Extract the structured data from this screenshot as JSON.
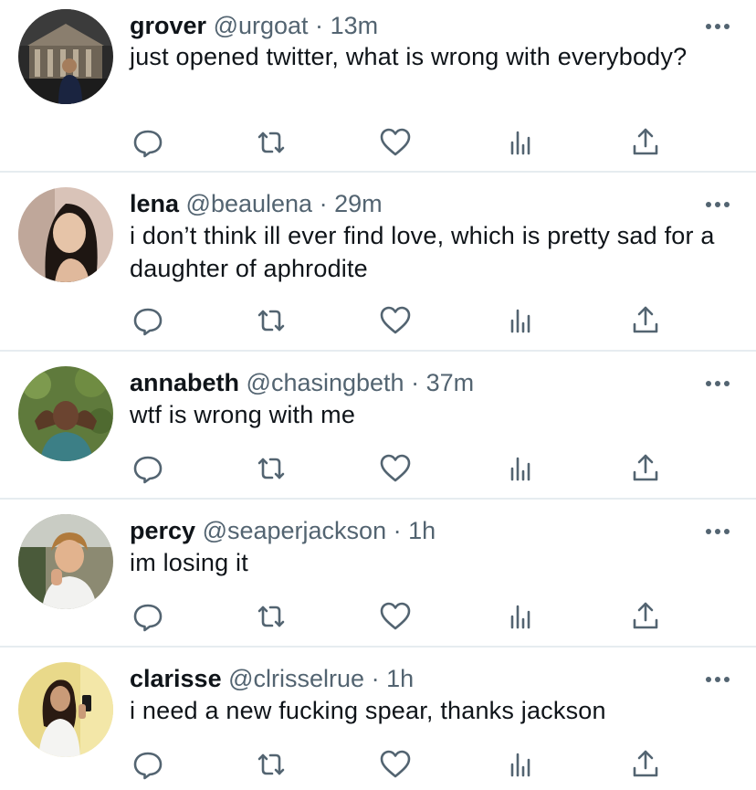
{
  "tweets": [
    {
      "name": "grover",
      "handle": "@urgoat",
      "sep": "·",
      "time": "13m",
      "text": "just opened twitter, what is wrong with everybody?"
    },
    {
      "name": "lena",
      "handle": "@beaulena",
      "sep": "·",
      "time": "29m",
      "text": "i don’t think ill ever find love, which is pretty sad for a daughter of aphrodite"
    },
    {
      "name": "annabeth",
      "handle": "@chasingbeth",
      "sep": "·",
      "time": "37m",
      "text": "wtf is wrong with me"
    },
    {
      "name": "percy",
      "handle": "@seaperjackson",
      "sep": "·",
      "time": "1h",
      "text": "im losing it"
    },
    {
      "name": "clarisse",
      "handle": "@clrisselrue",
      "sep": "·",
      "time": "1h",
      "text": "i need a new fucking spear, thanks jackson"
    }
  ],
  "icons": {
    "reply": "reply-icon",
    "retweet": "retweet-icon",
    "like": "like-icon",
    "views": "views-icon",
    "share": "share-icon",
    "more": "more-icon"
  },
  "colors": {
    "name": "#0f1419",
    "secondary": "#536471",
    "divider": "#e6ecf0"
  }
}
